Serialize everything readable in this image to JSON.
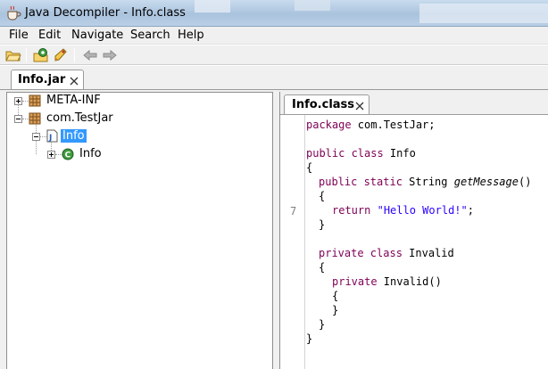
{
  "window": {
    "title": "Java Decompiler - Info.class"
  },
  "menu": {
    "items": [
      "File",
      "Edit",
      "Navigate",
      "Search",
      "Help"
    ]
  },
  "toolbar": {
    "buttons": [
      {
        "icon": "open-folder-icon"
      },
      {
        "icon": "open-type-icon"
      },
      {
        "icon": "search-rocket-icon"
      },
      {
        "icon": "back-arrow-icon"
      },
      {
        "icon": "forward-arrow-icon"
      }
    ]
  },
  "outer_tab": {
    "label": "Info.jar",
    "close": "close-icon"
  },
  "tree": {
    "items": [
      {
        "label": "META-INF",
        "icon": "package-icon",
        "expander": "plus",
        "selected": false
      },
      {
        "label": "com.TestJar",
        "icon": "package-icon",
        "expander": "minus",
        "selected": false
      },
      {
        "label": "Info",
        "icon": "java-file-icon",
        "expander": "minus",
        "selected": true
      },
      {
        "label": "Info",
        "icon": "class-icon",
        "expander": "plus",
        "selected": false
      }
    ]
  },
  "editor_tab": {
    "label": "Info.class",
    "close": "close-icon"
  },
  "code": {
    "line_number": "7",
    "lines": [
      {
        "kw": "package",
        "rest": " com.TestJar;"
      },
      {
        "kw": "public class",
        "rest": " Info"
      },
      {
        "text": "{"
      },
      {
        "kw": "public static",
        "rest": " String ",
        "method": "getMessage",
        "tail": "()"
      },
      {
        "text": "{"
      },
      {
        "kw": "return",
        "str": "\"Hello World!\"",
        "tail": ";"
      },
      {
        "text": "}"
      },
      {
        "kw": "private class",
        "rest": " Invalid"
      },
      {
        "text": "{"
      },
      {
        "kw": "private",
        "rest": " Invalid()"
      },
      {
        "text": "{"
      },
      {
        "text": "}"
      },
      {
        "text": "}"
      },
      {
        "text": "}"
      }
    ]
  },
  "colors": {
    "keyword": "#7f0055",
    "string": "#2a00ff",
    "selection": "#3399ff"
  }
}
